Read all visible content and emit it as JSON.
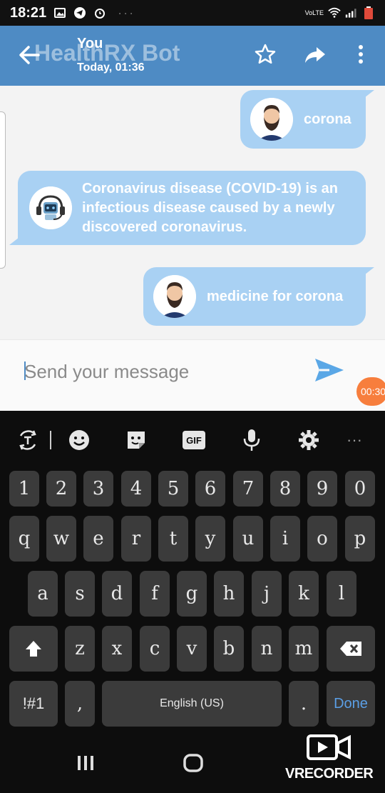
{
  "status_bar": {
    "time": "18:21",
    "network_label": "VoLTE"
  },
  "app_bar": {
    "title": "HealthRX Bot",
    "chat_user": "You",
    "chat_time": "Today, 01:36"
  },
  "messages": [
    {
      "sender": "user",
      "text": "corona"
    },
    {
      "sender": "bot",
      "text": "Coronavirus disease (COVID-19) is an infectious disease caused by a newly discovered coronavirus."
    },
    {
      "sender": "user",
      "text": "medicine for corona"
    }
  ],
  "input": {
    "placeholder": "Send your message"
  },
  "recording_badge": "00:30",
  "keyboard": {
    "number_row": [
      "1",
      "2",
      "3",
      "4",
      "5",
      "6",
      "7",
      "8",
      "9",
      "0"
    ],
    "row1": [
      "q",
      "w",
      "e",
      "r",
      "t",
      "y",
      "u",
      "i",
      "o",
      "p"
    ],
    "row2": [
      "a",
      "s",
      "d",
      "f",
      "g",
      "h",
      "j",
      "k",
      "l"
    ],
    "row3": [
      "z",
      "x",
      "c",
      "v",
      "b",
      "n",
      "m"
    ],
    "symbols_key": "!#1",
    "comma_key": ",",
    "space_label": "English (US)",
    "period_key": ".",
    "done_key": "Done",
    "gif_label": "GIF"
  },
  "watermark": "VRECORDER",
  "colors": {
    "app_bar": "#4e8bc4",
    "bubble": "#a9d1f3",
    "send": "#5aa7e6",
    "recording": "#f77e3d"
  }
}
